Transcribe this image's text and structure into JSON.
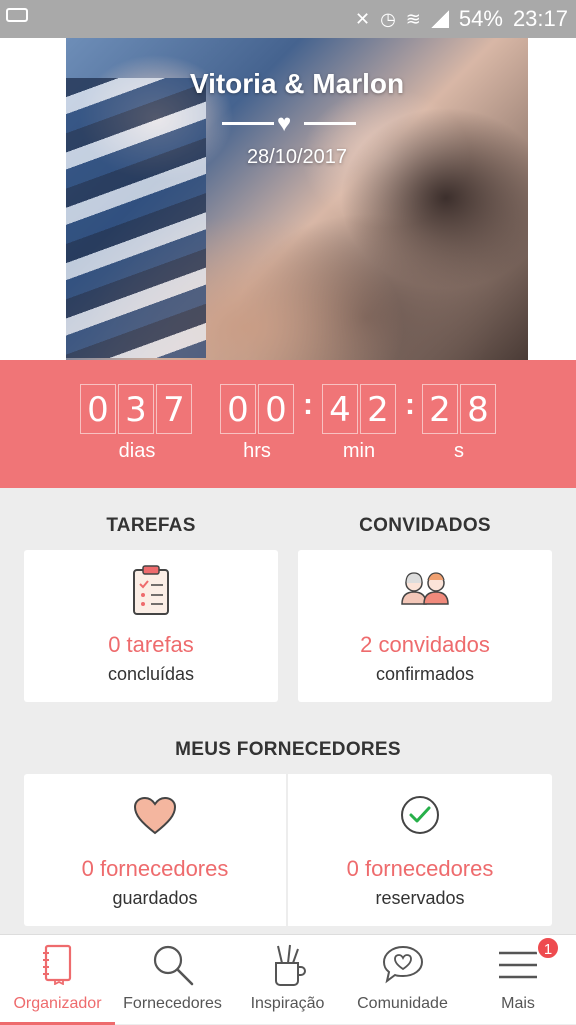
{
  "status_bar": {
    "battery_percent": "54%",
    "time": "23:17",
    "icons": [
      "voicemail-icon",
      "mute-icon",
      "alarm-icon",
      "wifi-icon",
      "signal-icon"
    ]
  },
  "hero": {
    "couple_names": "Vitoria & Marlon",
    "wedding_date": "28/10/2017",
    "icon": "heart-icon"
  },
  "countdown": {
    "days": [
      "0",
      "3",
      "7"
    ],
    "hours": [
      "0",
      "0"
    ],
    "minutes": [
      "4",
      "2"
    ],
    "seconds": [
      "2",
      "8"
    ],
    "labels": {
      "days": "dias",
      "hours": "hrs",
      "minutes": "min",
      "seconds": "s"
    },
    "accent_color": "#f07577"
  },
  "tasks": {
    "title": "TAREFAS",
    "count_text": "0 tarefas",
    "sub_text": "concluídas",
    "icon": "clipboard-checklist-icon"
  },
  "guests": {
    "title": "CONVIDADOS",
    "count_text": "2 convidados",
    "sub_text": "confirmados",
    "icon": "couple-icon"
  },
  "vendors": {
    "title": "MEUS FORNECEDORES",
    "saved": {
      "count_text": "0 fornecedores",
      "sub_text": "guardados",
      "icon": "heart-icon"
    },
    "booked": {
      "count_text": "0 fornecedores",
      "sub_text": "reservados",
      "icon": "check-circle-icon"
    }
  },
  "tabbar": {
    "items": [
      {
        "label": "Organizador",
        "icon": "notebook-icon",
        "active": true
      },
      {
        "label": "Fornecedores",
        "icon": "search-icon",
        "active": false
      },
      {
        "label": "Inspiração",
        "icon": "pencil-cup-icon",
        "active": false
      },
      {
        "label": "Comunidade",
        "icon": "chat-heart-icon",
        "active": false
      },
      {
        "label": "Mais",
        "icon": "menu-icon",
        "active": false
      }
    ],
    "badge_count": "1",
    "accent_color": "#ee6b6d"
  }
}
